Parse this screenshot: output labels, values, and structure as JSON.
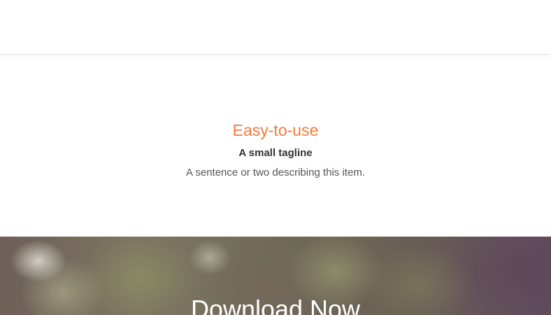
{
  "feature": {
    "title": "Easy-to-use",
    "tagline": "A small tagline",
    "description": "A sentence or two describing this item."
  },
  "cta": {
    "title": "Download Now"
  },
  "colors": {
    "accent": "#f47b3a",
    "tagline_text": "#333333",
    "body_text": "#555555"
  }
}
